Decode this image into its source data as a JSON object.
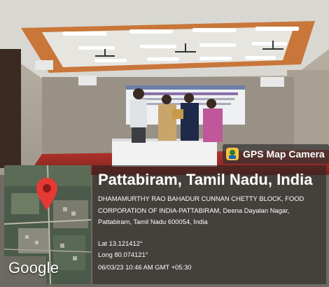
{
  "badge": {
    "label": "GPS Map Camera",
    "icon": "map-pin-icon"
  },
  "map": {
    "logo": "Google"
  },
  "location": {
    "title": "Pattabiram, Tamil Nadu, India",
    "address": "DHAMAMURTHY RAO BAHADUR CUNNAN CHETTY BLOCK, FOOD CORPORATION OF INDIA-PATTABIRAM, Deena Dayalan Nagar, Pattabiram, Tamil Nadu 600054, India",
    "lat": "Lat 13.121412°",
    "long": "Long 80.074121°",
    "datetime": "06/03/23 10:46 AM GMT +05:30"
  },
  "colors": {
    "pin": "#e53935",
    "ceiling_wood": "#c9763a",
    "carpet": "#b5332b"
  }
}
